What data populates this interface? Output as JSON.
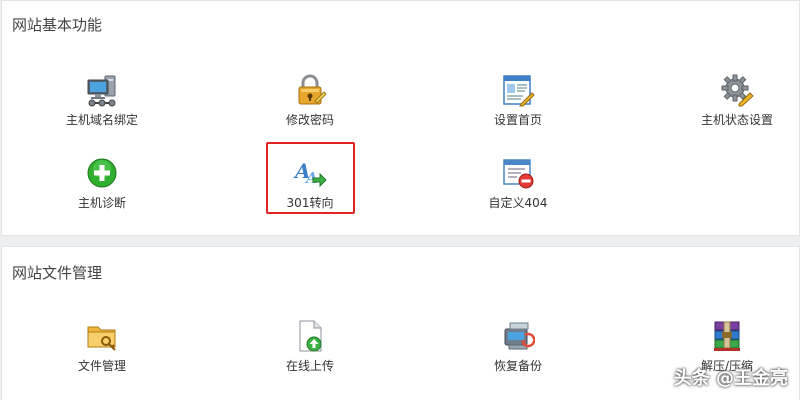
{
  "sections": {
    "basic": {
      "title": "网站基本功能",
      "items": [
        {
          "label": "主机域名绑定",
          "icon": "computer-network-icon"
        },
        {
          "label": "修改密码",
          "icon": "padlock-icon"
        },
        {
          "label": "设置首页",
          "icon": "webpage-edit-icon"
        },
        {
          "label": "主机状态设置",
          "icon": "gear-pencil-icon"
        },
        {
          "label": "主机诊断",
          "icon": "green-plus-icon"
        },
        {
          "label": "301转向",
          "icon": "font-redirect-icon"
        },
        {
          "label": "自定义404",
          "icon": "window-error-icon"
        }
      ]
    },
    "files": {
      "title": "网站文件管理",
      "items": [
        {
          "label": "文件管理",
          "icon": "folder-key-icon"
        },
        {
          "label": "在线上传",
          "icon": "document-upload-icon"
        },
        {
          "label": "恢复备份",
          "icon": "backup-restore-icon"
        },
        {
          "label": "解压/压缩",
          "icon": "archive-books-icon"
        }
      ]
    }
  },
  "watermark": "头条 @王金亮",
  "colors": {
    "highlight": "#e02424",
    "panel_bg": "#ffffff",
    "page_bg": "#eceeef"
  }
}
